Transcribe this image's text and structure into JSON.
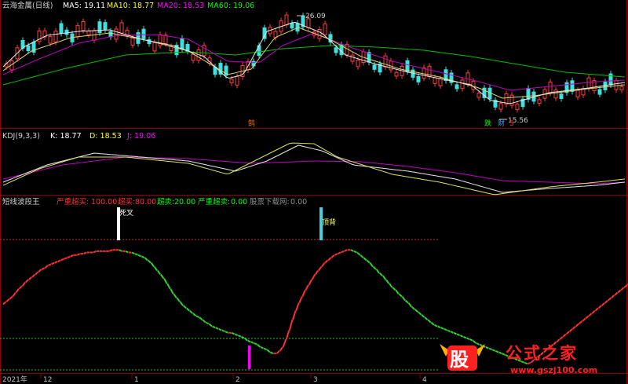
{
  "main_panel": {
    "title": "云海金属(日线)",
    "ma_items": [
      {
        "label": "MA5: 19.11",
        "color": "#ffffff"
      },
      {
        "label": "MA10: 18.77",
        "color": "#ffff00"
      },
      {
        "label": "MA20: 18.53",
        "color": "#ff00ff"
      },
      {
        "label": "MA60: 19.06",
        "color": "#00ff00"
      }
    ],
    "high_label": "26.09",
    "low_label": "15.56",
    "markers": [
      {
        "text": "鹄",
        "color": "#ff6a00"
      },
      {
        "text": "跌",
        "color": "#00ff00"
      },
      {
        "text": "财",
        "color": "#3d9bff"
      },
      {
        "text": "5",
        "color": "#ff3030"
      }
    ]
  },
  "kdj_panel": {
    "title": "KDJ(9,3,3)",
    "k_label": "K: 18.77",
    "d_label": "D: 18.53",
    "j_label": "J: 19.06"
  },
  "indicator_panel": {
    "title": "短线波段王",
    "items": [
      {
        "label": "严重超买:",
        "value": "100.00",
        "color": "#ff3030"
      },
      {
        "label": "超买:",
        "value": "80.00",
        "color": "#ff3030"
      },
      {
        "label": "超卖:",
        "value": "20.00",
        "color": "#00ff00"
      },
      {
        "label": "严重超卖:",
        "value": "0.00",
        "color": "#00ff00"
      },
      {
        "label": "股票下载网:",
        "value": "0.00",
        "color": "#808080"
      }
    ],
    "signal_dead_cross": "死叉",
    "signal_top_divergence": "顶背"
  },
  "x_axis": {
    "labels": [
      "2021年",
      "12",
      "1",
      "2",
      "3",
      "4"
    ]
  },
  "watermark": {
    "logo_char": "股",
    "text": "公式之家",
    "url": "www.gszj100.com"
  },
  "chart_data": [
    {
      "type": "line",
      "title": "云海金属(日线)",
      "note": "price panel with moving averages",
      "series": [
        {
          "name": "MA5",
          "current": 19.11
        },
        {
          "name": "MA10",
          "current": 18.77
        },
        {
          "name": "MA20",
          "current": 18.53
        },
        {
          "name": "MA60",
          "current": 19.06
        }
      ],
      "high": 26.09,
      "low": 15.56
    },
    {
      "type": "line",
      "title": "KDJ(9,3,3)",
      "series": [
        {
          "name": "K",
          "current": 18.77
        },
        {
          "name": "D",
          "current": 18.53
        },
        {
          "name": "J",
          "current": 19.06
        }
      ]
    },
    {
      "type": "line",
      "title": "短线波段王",
      "levels": [
        100,
        80,
        20,
        0
      ],
      "ylim": [
        0,
        100
      ],
      "values": [
        50,
        52,
        54,
        56,
        59,
        62,
        64,
        67,
        69,
        71,
        73,
        75,
        77,
        78,
        80,
        81,
        82,
        83,
        84,
        85,
        86,
        87,
        88,
        88,
        89,
        89,
        90,
        90,
        90,
        91,
        91,
        91,
        91,
        91,
        92,
        92,
        92,
        91,
        91,
        90,
        90,
        89,
        88,
        87,
        86,
        84,
        82,
        79,
        76,
        73,
        70,
        66,
        62,
        58,
        55,
        52,
        49,
        47,
        45,
        43,
        41,
        40,
        38,
        36,
        35,
        33,
        32,
        31,
        30,
        29,
        28,
        28,
        27,
        26,
        25,
        24,
        22,
        21,
        20,
        19,
        17,
        16,
        15,
        13,
        12,
        12,
        14,
        17,
        23,
        30,
        38,
        45,
        51,
        56,
        61,
        65,
        69,
        73,
        76,
        79,
        82,
        84,
        86,
        88,
        89,
        90,
        91,
        92,
        92,
        91,
        90,
        88,
        86,
        84,
        82,
        79,
        77,
        74,
        72,
        69,
        66,
        63,
        61,
        58,
        56,
        53,
        51,
        48,
        46,
        44,
        42,
        40,
        38,
        36,
        34,
        33,
        32,
        31,
        30,
        29,
        28,
        27,
        26,
        25,
        24,
        23,
        22,
        20,
        19,
        18,
        17,
        16,
        15,
        14,
        13,
        12,
        11,
        10,
        9,
        8,
        7,
        6,
        5,
        4,
        5,
        7,
        9,
        11,
        13,
        15,
        17,
        19,
        21,
        23,
        25,
        27,
        29,
        31,
        33,
        35,
        37,
        39,
        41,
        43,
        45,
        47,
        49,
        51,
        53,
        55,
        57,
        59,
        61,
        63,
        65,
        67,
        69,
        71,
        73
      ]
    }
  ]
}
